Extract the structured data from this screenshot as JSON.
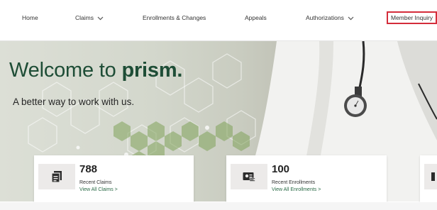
{
  "nav": {
    "home": "Home",
    "claims": "Claims",
    "enrollments": "Enrollments & Changes",
    "appeals": "Appeals",
    "authorizations": "Authorizations",
    "member_inquiry": "Member Inquiry"
  },
  "hero": {
    "title_prefix": "Welcome to ",
    "title_brand": "prism.",
    "subtitle": "A better way to work with us."
  },
  "cards": [
    {
      "count": "788",
      "label": "Recent Claims",
      "link": "View All Claims >",
      "icon": "document-stack-icon"
    },
    {
      "count": "100",
      "label": "Recent Enrollments",
      "link": "View All Enrollments >",
      "icon": "id-card-icon"
    }
  ],
  "colors": {
    "brand_green": "#1e4d36",
    "link_green": "#2a6a46",
    "highlight_red": "#d42d3b"
  }
}
